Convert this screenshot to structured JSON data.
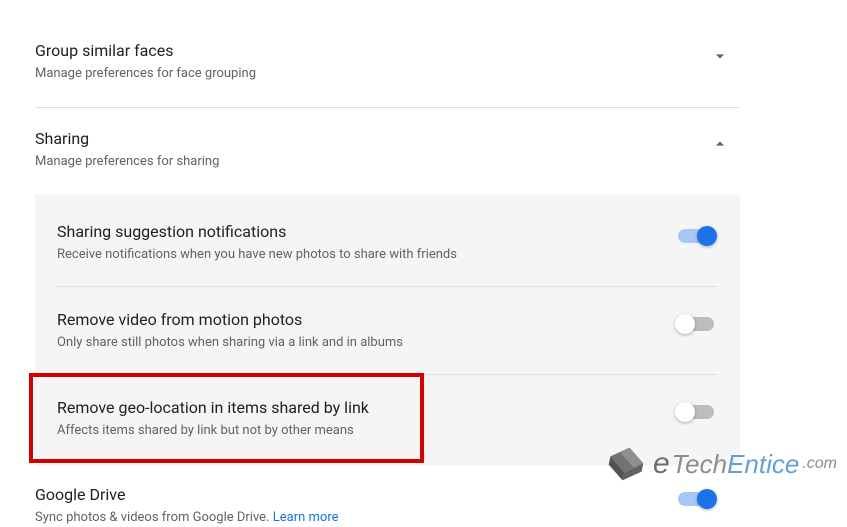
{
  "faces": {
    "title": "Group similar faces",
    "sub": "Manage preferences for face grouping"
  },
  "sharing": {
    "title": "Sharing",
    "sub": "Manage preferences for sharing"
  },
  "panel": {
    "suggest": {
      "title": "Sharing suggestion notifications",
      "sub": "Receive notifications when you have new photos to share with friends",
      "on": true
    },
    "motion": {
      "title": "Remove video from motion photos",
      "sub": "Only share still photos when sharing via a link and in albums",
      "on": false
    },
    "geo": {
      "title": "Remove geo-location in items shared by link",
      "sub": "Affects items shared by link but not by other means",
      "on": false
    }
  },
  "gdrive": {
    "title": "Google Drive",
    "sub_prefix": "Sync photos & videos from Google Drive. ",
    "learn": "Learn more",
    "on": true
  },
  "watermark": {
    "e": "e",
    "tech": "Tech",
    "entice": "Entice",
    "com": ".com"
  }
}
